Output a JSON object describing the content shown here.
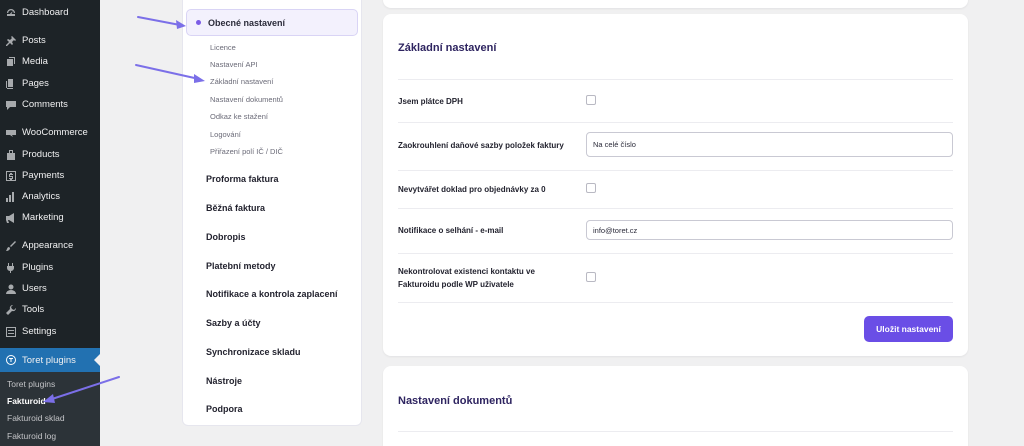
{
  "wp_sidebar": {
    "items": [
      {
        "label": "Dashboard",
        "icon": "dashboard-icon"
      },
      {
        "label": "Posts",
        "icon": "pin-icon"
      },
      {
        "label": "Media",
        "icon": "media-icon"
      },
      {
        "label": "Pages",
        "icon": "pages-icon"
      },
      {
        "label": "Comments",
        "icon": "comment-icon"
      },
      {
        "label": "WooCommerce",
        "icon": "woocommerce-icon"
      },
      {
        "label": "Products",
        "icon": "products-icon"
      },
      {
        "label": "Payments",
        "icon": "payments-icon"
      },
      {
        "label": "Analytics",
        "icon": "analytics-icon"
      },
      {
        "label": "Marketing",
        "icon": "megaphone-icon"
      },
      {
        "label": "Appearance",
        "icon": "brush-icon"
      },
      {
        "label": "Plugins",
        "icon": "plug-icon"
      },
      {
        "label": "Users",
        "icon": "users-icon"
      },
      {
        "label": "Tools",
        "icon": "wrench-icon"
      },
      {
        "label": "Settings",
        "icon": "settings-icon"
      },
      {
        "label": "Toret plugins",
        "icon": "toret-icon"
      }
    ],
    "submenu": [
      "Toret plugins",
      "Fakturoid",
      "Fakturoid sklad",
      "Fakturoid log"
    ]
  },
  "plugin_nav": {
    "active_label": "Obecné nastavení",
    "subitems": [
      "Licence",
      "Nastavení API",
      "Základní nastavení",
      "Nastavení dokumentů",
      "Odkaz ke stažení",
      "Logování",
      "Přiřazení polí IČ / DIČ"
    ],
    "sections": [
      "Proforma faktura",
      "Běžná faktura",
      "Dobropis",
      "Platební metody",
      "Notifikace a kontrola zaplacení",
      "Sazby a účty",
      "Synchronizace skladu",
      "Nástroje",
      "Podpora"
    ]
  },
  "basic_settings": {
    "title": "Základní nastavení",
    "vat_payer_label": "Jsem plátce DPH",
    "rounding_label": "Zaokrouhlení daňové sazby položek faktury",
    "rounding_value": "Na celé číslo",
    "no_doc_zero_label": "Nevytvářet doklad pro objednávky za 0",
    "notify_email_label": "Notifikace o selhání - e-mail",
    "notify_email_value": "info@toret.cz",
    "no_contact_check_label_1": "Nekontrolovat existenci kontaktu ve",
    "no_contact_check_label_2": "Fakturoidu podle WP uživatele",
    "save_label": "Uložit nastavení"
  },
  "doc_settings": {
    "title": "Nastavení dokumentů"
  },
  "colors": {
    "accent": "#6a4ee6",
    "wp_sidebar_bg": "#1d2327",
    "wp_active": "#2271b1",
    "arrow": "#7b6fe8"
  }
}
